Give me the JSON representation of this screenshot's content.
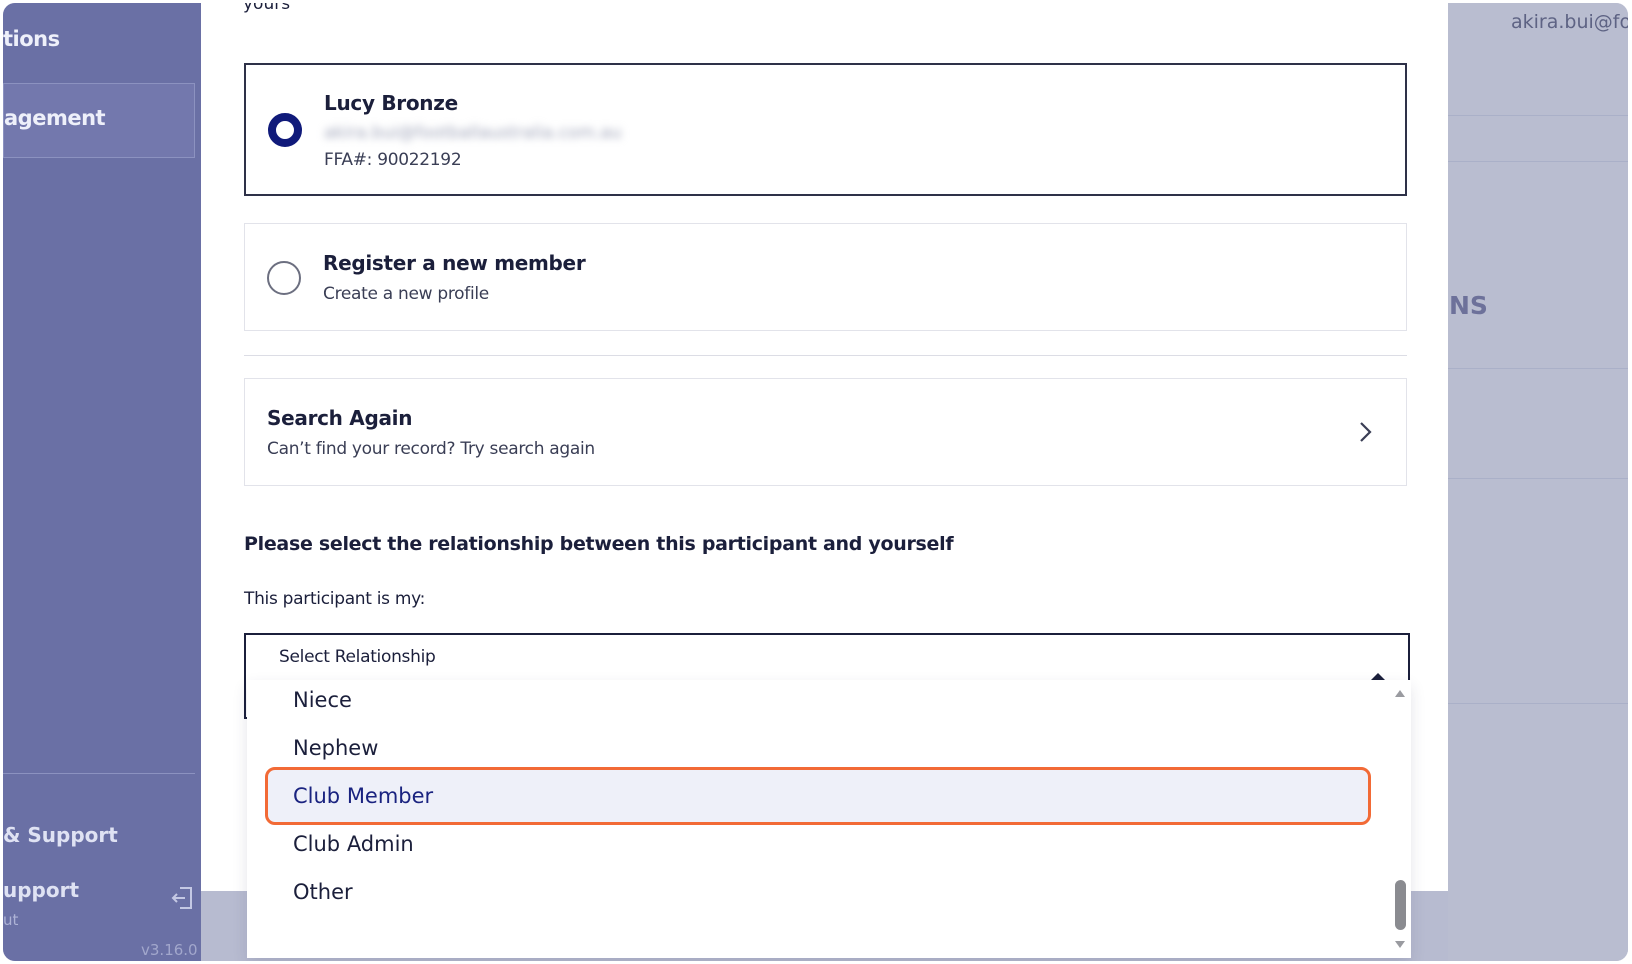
{
  "sidebar": {
    "item_a_fragment": "tions",
    "item_b_fragment": "agement",
    "help_fragment": "& Support",
    "support_fragment": "upport",
    "logout_fragment": "ut",
    "version": "v3.16.0"
  },
  "header": {
    "user_email_fragment": "akira.bui@fo"
  },
  "background": {
    "heading_fragment": "NS"
  },
  "modal": {
    "intro_fragment": "yours",
    "member_option": {
      "name": "Lucy Bronze",
      "email_redacted": "akira.bui@footballaustralia.com.au",
      "ffa_number": "FFA#: 90022192",
      "selected": true
    },
    "new_member_option": {
      "title": "Register a new member",
      "subtitle": "Create a new profile",
      "selected": false
    },
    "search_again": {
      "title": "Search Again",
      "subtitle": "Can’t find your record? Try search again"
    },
    "relationship_heading": "Please select the relationship between this participant and yourself",
    "participant_label": "This participant is my:",
    "select": {
      "placeholder": "Select Relationship",
      "options": [
        "Niece",
        "Nephew",
        "Club Member",
        "Club Admin",
        "Other"
      ],
      "highlighted_option": "Club Member"
    }
  },
  "colors": {
    "accent": "#101a7a",
    "highlight_border": "#f26a36",
    "sidebar_bg": "#6a70a5",
    "text": "#1b1f3b"
  }
}
